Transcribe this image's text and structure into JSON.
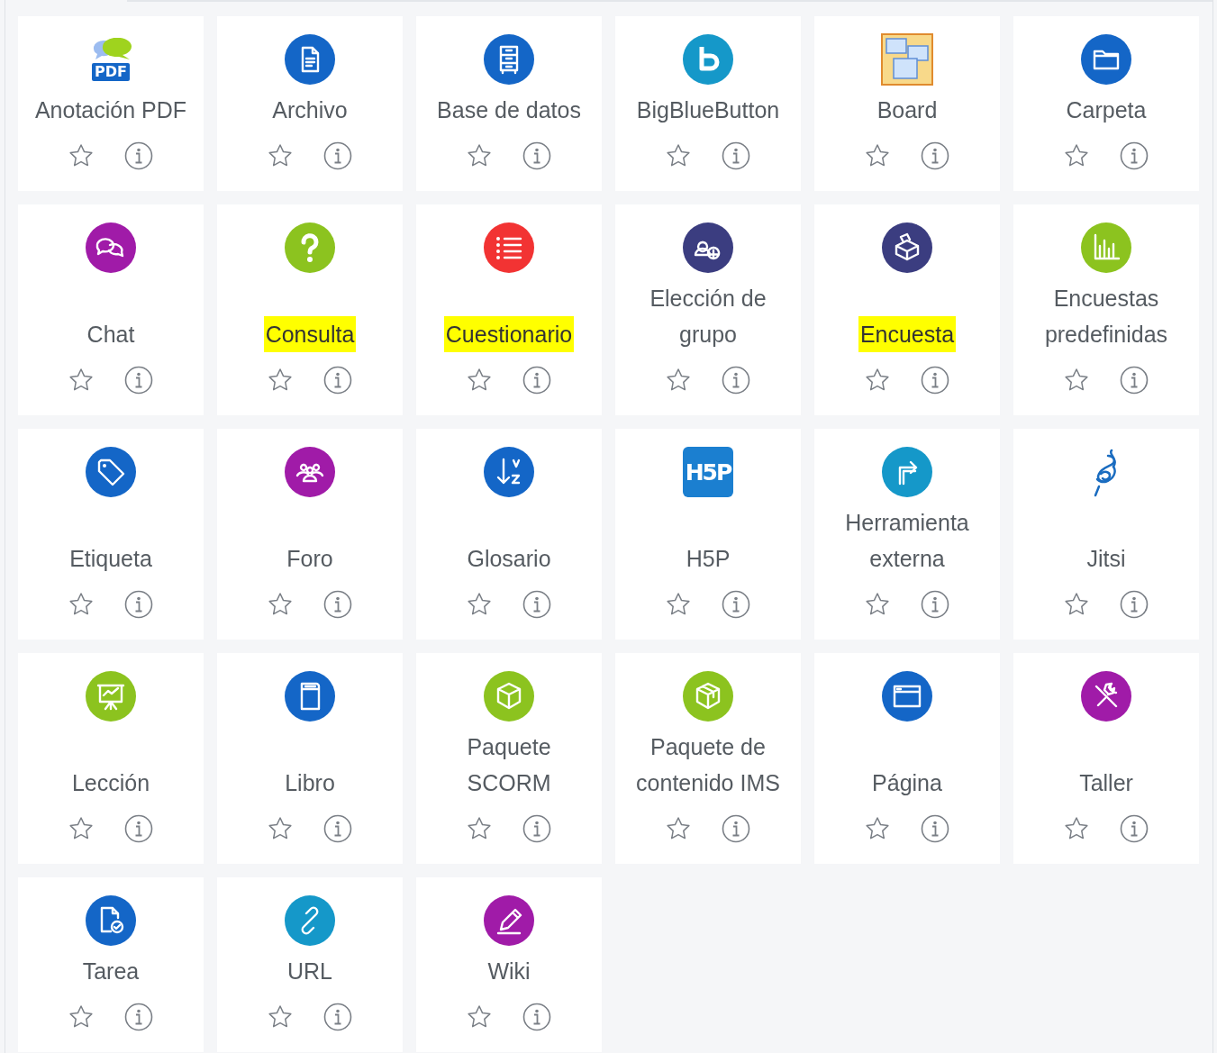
{
  "activities": [
    {
      "label": "Anotación PDF",
      "kind": "pdf",
      "color": "#1466c7",
      "badge": "PDF",
      "highlighted": false,
      "starred": false
    },
    {
      "label": "Archivo",
      "kind": "circle",
      "color": "#1466c7",
      "highlighted": false,
      "starred": false
    },
    {
      "label": "Base de datos",
      "kind": "circle",
      "color": "#1466c7",
      "highlighted": false,
      "starred": false
    },
    {
      "label": "BigBlueButton",
      "kind": "circle",
      "color": "#1598c9",
      "highlighted": false,
      "starred": false
    },
    {
      "label": "Board",
      "kind": "plain",
      "color": "#f8d98a",
      "highlighted": false,
      "starred": false
    },
    {
      "label": "Carpeta",
      "kind": "circle",
      "color": "#1466c7",
      "highlighted": false,
      "starred": false
    },
    {
      "label": "Chat",
      "kind": "circle",
      "color": "#a01ba8",
      "highlighted": false,
      "starred": false
    },
    {
      "label": "Consulta",
      "kind": "circle",
      "color": "#8cc31f",
      "highlighted": true,
      "starred": false
    },
    {
      "label": "Cuestionario",
      "kind": "circle",
      "color": "#f23333",
      "highlighted": true,
      "starred": false
    },
    {
      "label": "Elección de\ngrupo",
      "kind": "circle",
      "color": "#3b3d80",
      "highlighted": false,
      "starred": false
    },
    {
      "label": "Encuesta",
      "kind": "circle",
      "color": "#3b3d80",
      "highlighted": true,
      "starred": false
    },
    {
      "label": "Encuestas\npredefinidas",
      "kind": "circle",
      "color": "#8cc31f",
      "highlighted": false,
      "starred": false
    },
    {
      "label": "Etiqueta",
      "kind": "circle",
      "color": "#1466c7",
      "highlighted": false,
      "starred": false
    },
    {
      "label": "Foro",
      "kind": "circle",
      "color": "#a01ba8",
      "highlighted": false,
      "starred": false
    },
    {
      "label": "Glosario",
      "kind": "circle",
      "color": "#1466c7",
      "highlighted": false,
      "starred": false
    },
    {
      "label": "H5P",
      "kind": "square",
      "color": "#1b7fd0",
      "badge": "H5P",
      "highlighted": false,
      "starred": false
    },
    {
      "label": "Herramienta\nexterna",
      "kind": "circle",
      "color": "#1598c9",
      "highlighted": false,
      "starred": false
    },
    {
      "label": "Jitsi",
      "kind": "plain",
      "color": "#1a6cc0",
      "highlighted": false,
      "starred": false
    },
    {
      "label": "Lección",
      "kind": "circle",
      "color": "#8cc31f",
      "highlighted": false,
      "starred": false
    },
    {
      "label": "Libro",
      "kind": "circle",
      "color": "#1466c7",
      "highlighted": false,
      "starred": false
    },
    {
      "label": "Paquete\nSCORM",
      "kind": "circle",
      "color": "#8cc31f",
      "highlighted": false,
      "starred": false
    },
    {
      "label": "Paquete de\ncontenido IMS",
      "kind": "circle",
      "color": "#8cc31f",
      "highlighted": false,
      "starred": false
    },
    {
      "label": "Página",
      "kind": "circle",
      "color": "#1466c7",
      "highlighted": false,
      "starred": false
    },
    {
      "label": "Taller",
      "kind": "circle",
      "color": "#a01ba8",
      "highlighted": false,
      "starred": false
    },
    {
      "label": "Tarea",
      "kind": "circle",
      "color": "#1466c7",
      "highlighted": false,
      "starred": false
    },
    {
      "label": "URL",
      "kind": "circle",
      "color": "#1598c9",
      "highlighted": false,
      "starred": false
    },
    {
      "label": "Wiki",
      "kind": "circle",
      "color": "#a01ba8",
      "highlighted": false,
      "starred": false
    }
  ]
}
